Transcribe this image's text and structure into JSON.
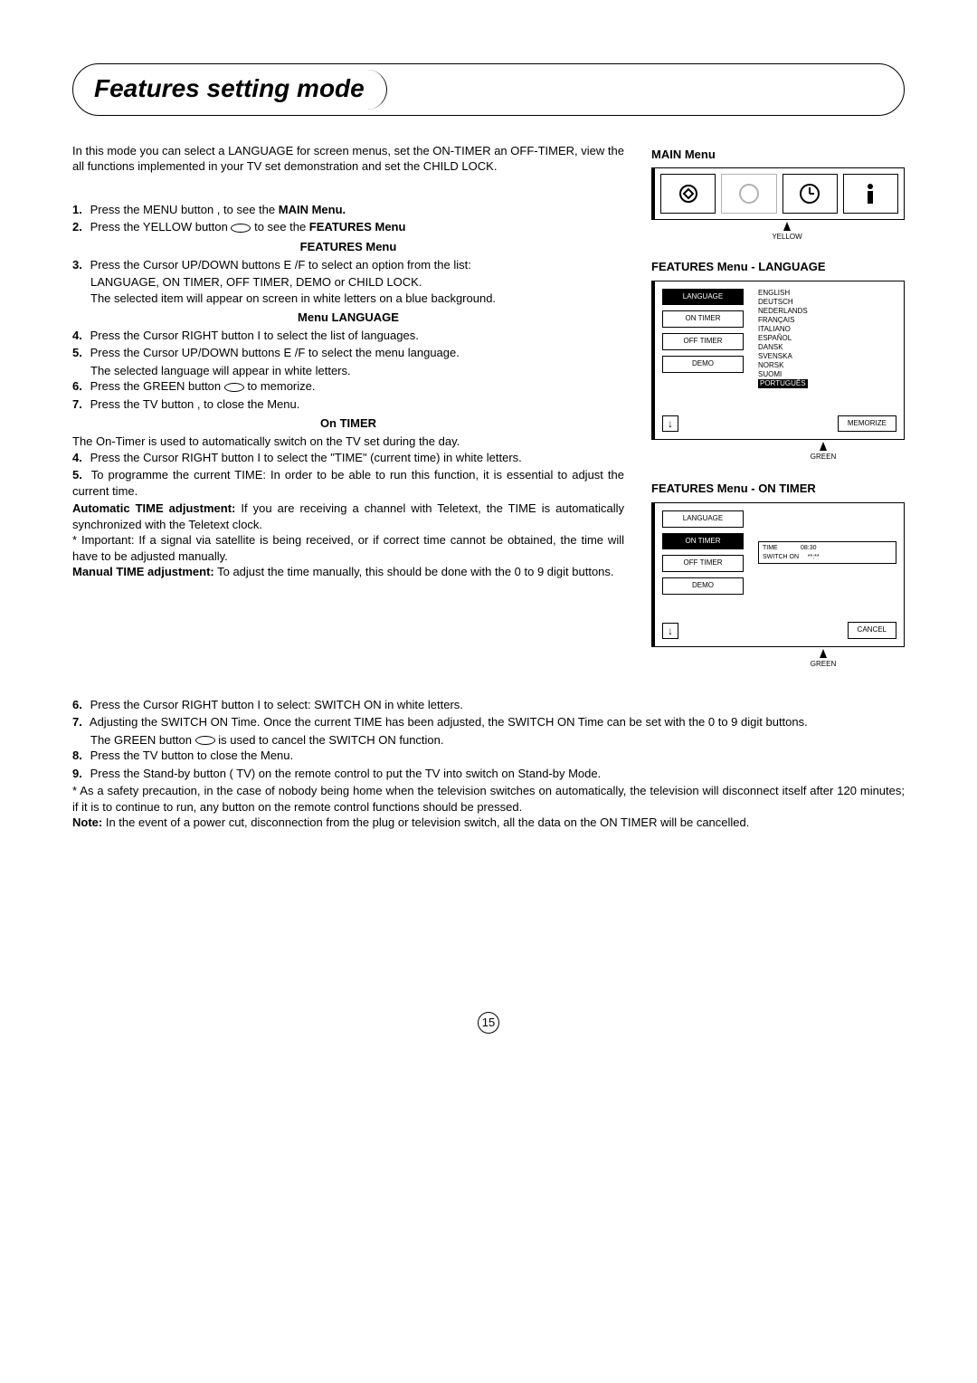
{
  "title": "Features setting mode",
  "intro": "In this mode you can select a LANGUAGE for screen menus, set the ON-TIMER an OFF-TIMER, view the all functions implemented in your TV set demonstration and set the CHILD LOCK.",
  "steps_a": [
    {
      "n": "1.",
      "t": "Press the MENU button      , to see the ",
      "b": "MAIN Menu."
    },
    {
      "n": "2.",
      "t": "Press the YELLOW button ",
      "oval": true,
      "t2": " to see the ",
      "b": "FEATURES Menu"
    }
  ],
  "sec_features": "FEATURES Menu",
  "step3a": "Press the Cursor UP/DOWN buttons E      /F       to select an option from the list:",
  "step3b": "LANGUAGE, ON TIMER, OFF TIMER, DEMO or CHILD LOCK.",
  "step3c": "The selected item will appear on screen in white letters on a blue background.",
  "sec_lang": "Menu LANGUAGE",
  "step4": "Press the Cursor RIGHT button  I  to select the list of languages.",
  "step5a": "Press the Cursor UP/DOWN buttons E    /F     to select the menu language.",
  "step5b": "The selected language will appear in white letters.",
  "step6": "Press the GREEN button ",
  "step6b": " to memorize.",
  "step7": "Press the TV button      , to close the Menu.",
  "sec_timer": "On TIMER",
  "timer_intro": "The On-Timer is used to automatically switch on the TV set during the day.",
  "t4": "Press the Cursor RIGHT button  I  to select the \"TIME\" (current time) in white letters.",
  "t5": "To programme the current TIME: In order to be able to run this function, it is essential to adjust the current time.",
  "t_auto_b": "Automatic TIME adjustment:",
  "t_auto": " If you are receiving a channel with Teletext, the TIME is automatically synchronized with the Teletext clock.",
  "t_imp": "* Important: If a signal via satellite is being received, or if correct time cannot be obtained, the time will have to be adjusted manually.",
  "t_man_b": "Manual TIME adjustment:",
  "t_man": " To adjust the time manually, this should be done with the 0 to 9 digit buttons.",
  "f6": "Press the Cursor RIGHT button  I  to select: SWITCH ON in white letters.",
  "f7": "Adjusting the SWITCH ON Time. Once the current TIME has been adjusted, the SWITCH ON Time can be set with the 0 to 9 digit buttons.",
  "f7b": "The GREEN button ",
  "f7c": " is used to cancel the SWITCH ON function.",
  "f8": "Press the TV button      to close the Menu.",
  "f9": "Press the Stand-by button  (      TV) on the remote control to put the TV into switch on Stand-by Mode.",
  "safety": "* As a safety precaution, in the case of nobody being home when the television switches on automatically, the television will disconnect itself after 120 minutes; if it is to continue to run, any button on the remote control functions should be pressed.",
  "note_b": "Note:",
  "note": " In the event of a power cut, disconnection from the plug or television switch, all the data on the ON TIMER will be cancelled.",
  "right": {
    "main_title": "MAIN Menu",
    "yellow": "YELLOW",
    "feat_lang_title": "FEATURES Menu - LANGUAGE",
    "osd1_left": [
      "LANGUAGE",
      "ON TIMER",
      "OFF TIMER",
      "DEMO"
    ],
    "osd1_langs": [
      "ENGLISH",
      "DEUTSCH",
      "NEDERLANDS",
      "FRANÇAIS",
      "ITALIANO",
      "ESPAÑOL",
      "DANSK",
      "SVENSKA",
      "NORSK",
      "SUOMI",
      "PORTUGUÊS"
    ],
    "memorize": "MEMORIZE",
    "green": "GREEN",
    "feat_timer_title": "FEATURES Menu - ON TIMER",
    "osd2_left": [
      "LANGUAGE",
      "ON TIMER",
      "OFF TIMER",
      "DEMO"
    ],
    "timer_detail": "TIME             08:30\nSWITCH ON     **:**",
    "cancel": "CANCEL"
  },
  "page": "15"
}
